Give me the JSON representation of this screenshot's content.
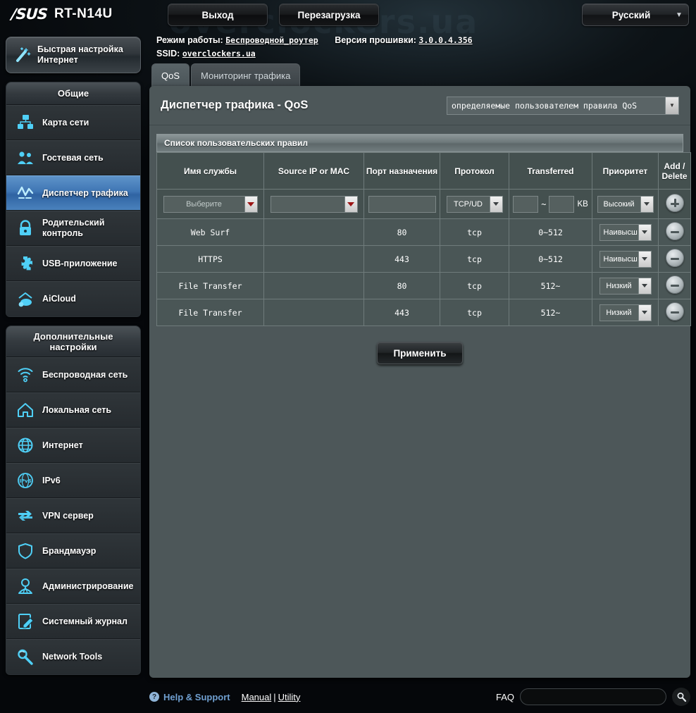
{
  "header": {
    "brand": "/SUS",
    "model": "RT-N14U",
    "logout_label": "Выход",
    "reboot_label": "Перезагрузка",
    "language": "Русский",
    "watermark": "overclockers.ua"
  },
  "info": {
    "mode_label": "Режим работы:",
    "mode_value": "Беспроводной_роутер",
    "firmware_label": "Версия прошивки:",
    "firmware_value": "3.0.0.4.356",
    "ssid_label": "SSID:",
    "ssid_value": "overclockers.ua"
  },
  "tabs": [
    {
      "label": "QoS",
      "active": true
    },
    {
      "label": "Мониторинг трафика",
      "active": false
    }
  ],
  "sidebar": {
    "quick_setup": "Быстрая настройка Интернет",
    "quick_setup_line1": "Быстрая настройка",
    "quick_setup_line2": "Интернет",
    "groups": [
      {
        "title": "Общие",
        "items": [
          {
            "label": "Карта сети",
            "icon": "network-map-icon",
            "active": false
          },
          {
            "label": "Гостевая сеть",
            "icon": "guest-network-icon",
            "active": false
          },
          {
            "label": "Диспетчер трафика",
            "icon": "traffic-manager-icon",
            "active": true
          },
          {
            "label": "Родительский контроль",
            "icon": "parental-control-icon",
            "active": false
          },
          {
            "label": "USB-приложение",
            "icon": "usb-application-icon",
            "active": false
          },
          {
            "label": "AiCloud",
            "icon": "aicloud-icon",
            "active": false
          }
        ]
      },
      {
        "title": "Дополнительные настройки",
        "items": [
          {
            "label": "Беспроводная сеть",
            "icon": "wireless-icon",
            "active": false
          },
          {
            "label": "Локальная сеть",
            "icon": "lan-icon",
            "active": false
          },
          {
            "label": "Интернет",
            "icon": "wan-globe-icon",
            "active": false
          },
          {
            "label": "IPv6",
            "icon": "ipv6-icon",
            "active": false
          },
          {
            "label": "VPN сервер",
            "icon": "vpn-icon",
            "active": false
          },
          {
            "label": "Брандмауэр",
            "icon": "firewall-shield-icon",
            "active": false
          },
          {
            "label": "Администрирование",
            "icon": "administration-icon",
            "active": false
          },
          {
            "label": "Системный журнал",
            "icon": "system-log-icon",
            "active": false
          },
          {
            "label": "Network Tools",
            "icon": "network-tools-icon",
            "active": false
          }
        ]
      }
    ]
  },
  "main": {
    "title": "Диспетчер трафика - QoS",
    "mode_selected": "определяемые пользователем правила QoS",
    "list_title": "Список пользовательских правил",
    "columns": [
      "Имя службы",
      "Source IP or MAC",
      "Порт назначения",
      "Протокол",
      "Transferred",
      "Приоритет",
      "Add / Delete"
    ],
    "add_delete_line1": "Add /",
    "add_delete_line2": "Delete",
    "input_row": {
      "service_placeholder": "Выберите",
      "source_value": "",
      "port_value": "",
      "protocol": "TCP/UD",
      "transferred_from": "",
      "transferred_to": "",
      "transferred_unit": "KB",
      "priority": "Высокий"
    },
    "rows": [
      {
        "service": "Web Surf",
        "source": "",
        "port": "80",
        "protocol": "tcp",
        "transferred": "0~512",
        "priority": "Наивысш"
      },
      {
        "service": "HTTPS",
        "source": "",
        "port": "443",
        "protocol": "tcp",
        "transferred": "0~512",
        "priority": "Наивысш"
      },
      {
        "service": "File Transfer",
        "source": "",
        "port": "80",
        "protocol": "tcp",
        "transferred": "512~",
        "priority": "Низкий"
      },
      {
        "service": "File Transfer",
        "source": "",
        "port": "443",
        "protocol": "tcp",
        "transferred": "512~",
        "priority": "Низкий"
      }
    ],
    "apply_label": "Применить"
  },
  "footer": {
    "help_label": "Help & Support",
    "manual_label": "Manual",
    "separator": "|",
    "utility_label": "Utility",
    "faq_label": "FAQ",
    "faq_value": ""
  },
  "colors": {
    "accent_blue": "#4a82bd",
    "icon_cyan": "#44c8f5",
    "panel_bg": "#4d5759",
    "link_blue": "#6f9fd0"
  }
}
